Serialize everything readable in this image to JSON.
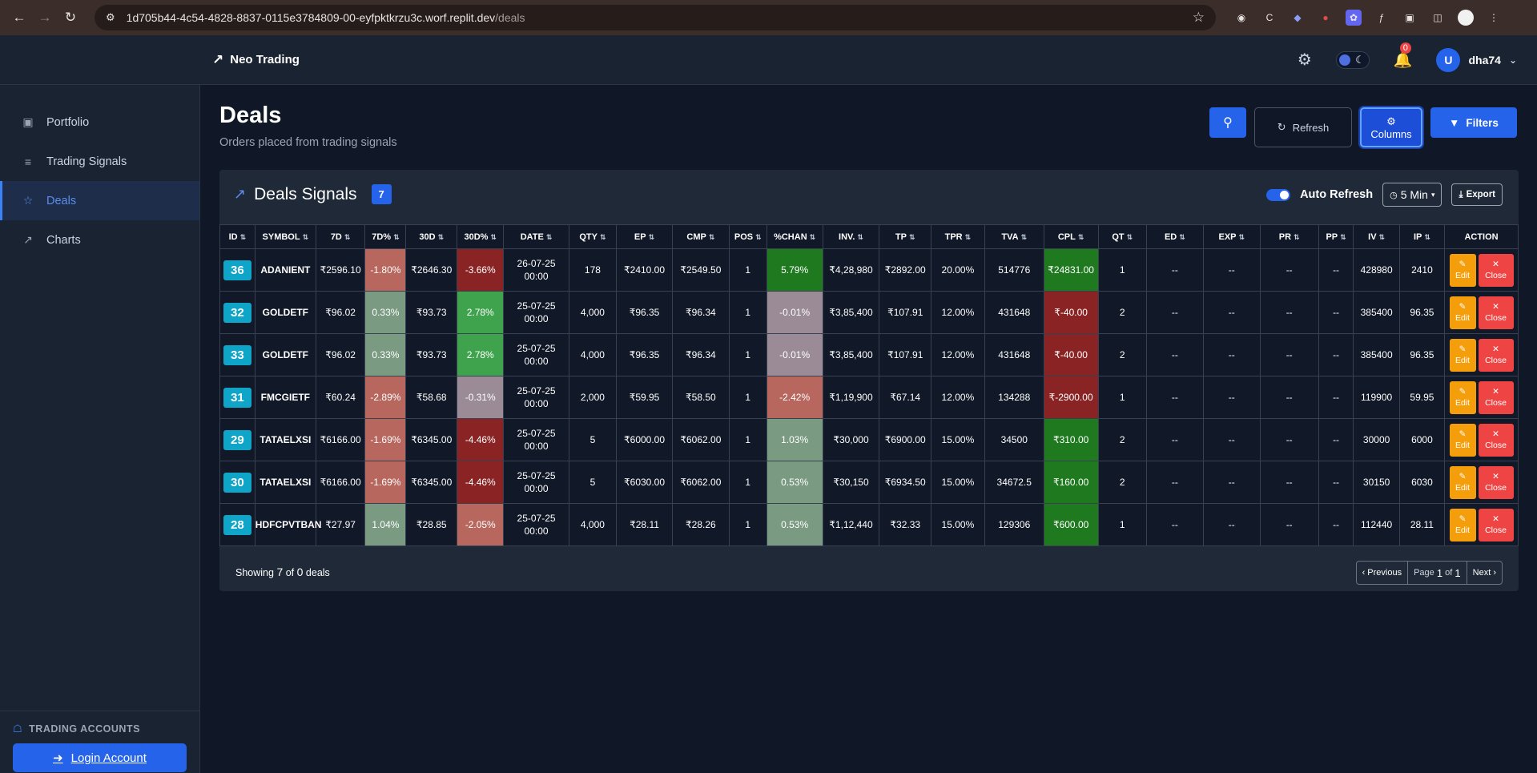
{
  "browser": {
    "url_main": "1d705b44-4c54-4828-8837-0115e3784809-00-eyfpktkrzu3c.worf.replit.dev",
    "url_path": "/deals"
  },
  "header": {
    "brand": "Neo Trading",
    "notification_count": "0",
    "user_initial": "U",
    "username": "dha74"
  },
  "sidebar": {
    "items": [
      {
        "label": "Portfolio",
        "icon": "briefcase-icon"
      },
      {
        "label": "Trading Signals",
        "icon": "list-icon"
      },
      {
        "label": "Deals",
        "icon": "handshake-icon"
      },
      {
        "label": "Charts",
        "icon": "chart-line-icon"
      }
    ],
    "trading_accounts": "TRADING ACCOUNTS",
    "login_label": "Login Account"
  },
  "page": {
    "title": "Deals",
    "subtitle": "Orders placed from trading signals",
    "refresh_label": "Refresh",
    "columns_label": "Columns",
    "filters_label": "Filters"
  },
  "card": {
    "title": "Deals Signals",
    "count": "7",
    "auto_refresh_label": "Auto Refresh",
    "interval": "5 Min",
    "export_label": "Export"
  },
  "table": {
    "headers": [
      "ID",
      "SYMBOL",
      "7D",
      "7D%",
      "30D",
      "30D%",
      "DATE",
      "QTY",
      "EP",
      "CMP",
      "POS",
      "%CHAN",
      "INV.",
      "TP",
      "TPR",
      "TVA",
      "CPL",
      "QT",
      "ED",
      "EXP",
      "PR",
      "PP",
      "IV",
      "IP",
      "ACTION"
    ],
    "edit_label": "Edit",
    "close_label": "Close",
    "rows": [
      [
        "36",
        "ADANIENT",
        "₹2596.10",
        "-1.80%",
        "₹2646.30",
        "-3.66%",
        "26-07-25 00:00",
        "178",
        "₹2410.00",
        "₹2549.50",
        "1",
        "5.79%",
        "₹4,28,980",
        "₹2892.00",
        "20.00%",
        "514776",
        "₹24831.00",
        "1",
        "--",
        "--",
        "--",
        "--",
        "428980",
        "2410"
      ],
      [
        "32",
        "GOLDETF",
        "₹96.02",
        "0.33%",
        "₹93.73",
        "2.78%",
        "25-07-25 00:00",
        "4,000",
        "₹96.35",
        "₹96.34",
        "1",
        "-0.01%",
        "₹3,85,400",
        "₹107.91",
        "12.00%",
        "431648",
        "₹-40.00",
        "2",
        "--",
        "--",
        "--",
        "--",
        "385400",
        "96.35"
      ],
      [
        "33",
        "GOLDETF",
        "₹96.02",
        "0.33%",
        "₹93.73",
        "2.78%",
        "25-07-25 00:00",
        "4,000",
        "₹96.35",
        "₹96.34",
        "1",
        "-0.01%",
        "₹3,85,400",
        "₹107.91",
        "12.00%",
        "431648",
        "₹-40.00",
        "2",
        "--",
        "--",
        "--",
        "--",
        "385400",
        "96.35"
      ],
      [
        "31",
        "FMCGIETF",
        "₹60.24",
        "-2.89%",
        "₹58.68",
        "-0.31%",
        "25-07-25 00:00",
        "2,000",
        "₹59.95",
        "₹58.50",
        "1",
        "-2.42%",
        "₹1,19,900",
        "₹67.14",
        "12.00%",
        "134288",
        "₹-2900.00",
        "1",
        "--",
        "--",
        "--",
        "--",
        "119900",
        "59.95"
      ],
      [
        "29",
        "TATAELXSI",
        "₹6166.00",
        "-1.69%",
        "₹6345.00",
        "-4.46%",
        "25-07-25 00:00",
        "5",
        "₹6000.00",
        "₹6062.00",
        "1",
        "1.03%",
        "₹30,000",
        "₹6900.00",
        "15.00%",
        "34500",
        "₹310.00",
        "2",
        "--",
        "--",
        "--",
        "--",
        "30000",
        "6000"
      ],
      [
        "30",
        "TATAELXSI",
        "₹6166.00",
        "-1.69%",
        "₹6345.00",
        "-4.46%",
        "25-07-25 00:00",
        "5",
        "₹6030.00",
        "₹6062.00",
        "1",
        "0.53%",
        "₹30,150",
        "₹6934.50",
        "15.00%",
        "34672.5",
        "₹160.00",
        "2",
        "--",
        "--",
        "--",
        "--",
        "30150",
        "6030"
      ],
      [
        "28",
        "HDFCPVTBAN",
        "₹27.97",
        "1.04%",
        "₹28.85",
        "-2.05%",
        "25-07-25 00:00",
        "4,000",
        "₹28.11",
        "₹28.26",
        "1",
        "0.53%",
        "₹1,12,440",
        "₹32.33",
        "15.00%",
        "129306",
        "₹600.00",
        "1",
        "--",
        "--",
        "--",
        "--",
        "112440",
        "28.11"
      ]
    ],
    "cell_colors": {
      "3": [
        "#b8675e",
        "#7a9a82",
        "#7a9a82",
        "#b8675e",
        "#b8675e",
        "#b8675e",
        "#7a9a82"
      ],
      "5": [
        "#8a2323",
        "#3fa34d",
        "#3fa34d",
        "#9a8b96",
        "#8a2323",
        "#8a2323",
        "#b8675e"
      ],
      "11": [
        "#1f7a1f",
        "#9a8b96",
        "#9a8b96",
        "#b8675e",
        "#7a9a82",
        "#7a9a82",
        "#7a9a82"
      ],
      "16": [
        "#1f7a1f",
        "#8a2323",
        "#8a2323",
        "#8a2323",
        "#1f7a1f",
        "#1f7a1f",
        "#1f7a1f"
      ]
    }
  },
  "footer": {
    "showing_prefix": "Showing",
    "showing_shown": "7",
    "showing_mid": "of",
    "showing_total": "0",
    "showing_suffix": "deals",
    "previous": "Previous",
    "page_prefix": "Page",
    "page_current": "1",
    "page_of": "of",
    "page_total": "1",
    "next": "Next"
  }
}
